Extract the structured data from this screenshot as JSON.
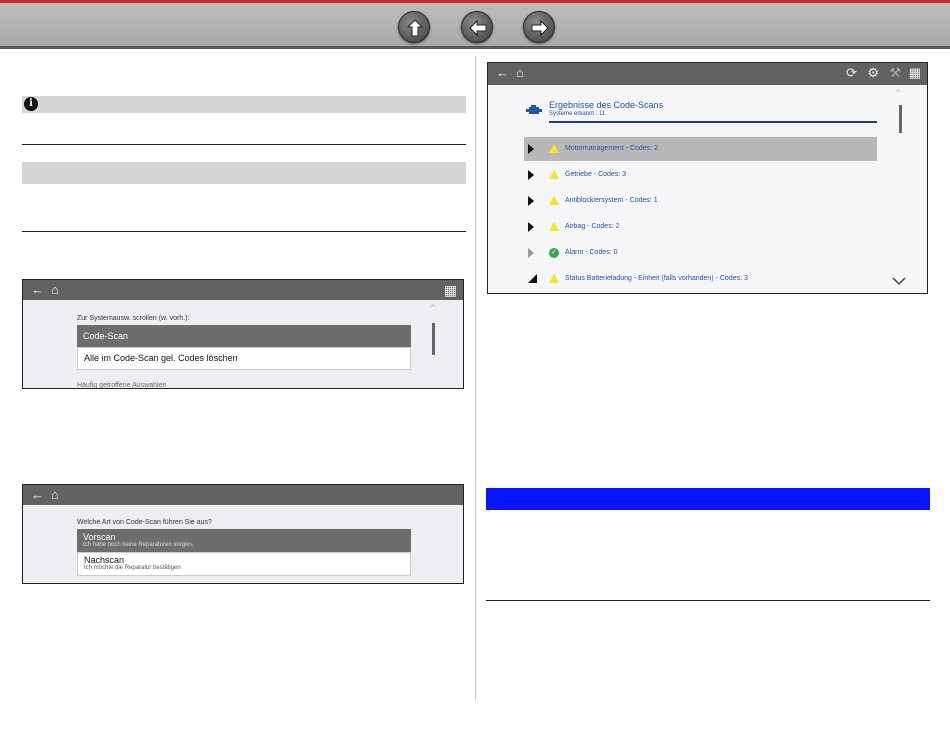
{
  "left_shot1": {
    "label": "Zur Systemausw. scrollen (w. vorh.):",
    "items": [
      "Code-Scan",
      "Alle im Code-Scan gel. Codes löschen"
    ],
    "footer": "Häufig getroffene Auswahlen"
  },
  "left_shot2": {
    "label": "Welche Art von Code-Scan führen Sie aus?",
    "items": [
      {
        "title": "Vorscan",
        "sub": "Ich habe noch keine Reparaturen vorgen."
      },
      {
        "title": "Nachscan",
        "sub": "Ich möchte die Reparatur bestätigen"
      }
    ]
  },
  "results": {
    "title": "Ergebnisse des Code-Scans",
    "subtitle": "Systeme erkannt : 11",
    "rows": [
      {
        "text": "Motormanagement   - Codes: 2",
        "status": "warn",
        "selected": true
      },
      {
        "text": "Getriebe   - Codes: 3",
        "status": "warn",
        "selected": false
      },
      {
        "text": "Antiblockiersystem   - Codes: 1",
        "status": "warn",
        "selected": false
      },
      {
        "text": "Airbag   - Codes: 2",
        "status": "warn",
        "selected": false
      },
      {
        "text": "Alarm   - Codes: 0",
        "status": "ok",
        "selected": false
      },
      {
        "text": "Status Batterieladung - Einheit (falls vorhanden)   - Codes: 3",
        "status": "warn",
        "selected": false
      }
    ]
  },
  "icons": {
    "nav": [
      "up-arrow-icon",
      "back-arrow-icon",
      "forward-arrow-icon"
    ],
    "toolbar": [
      "back-icon",
      "home-icon",
      "refresh-icon",
      "vehicle-icon",
      "tools-icon",
      "save-icon",
      "grid-icon"
    ]
  },
  "colors": {
    "accent_red": "#d0262b",
    "header_blue": "#0a14ff",
    "link_blue": "#1e56a8",
    "warn_yellow": "#f4e42a",
    "ok_green": "#38a845"
  }
}
